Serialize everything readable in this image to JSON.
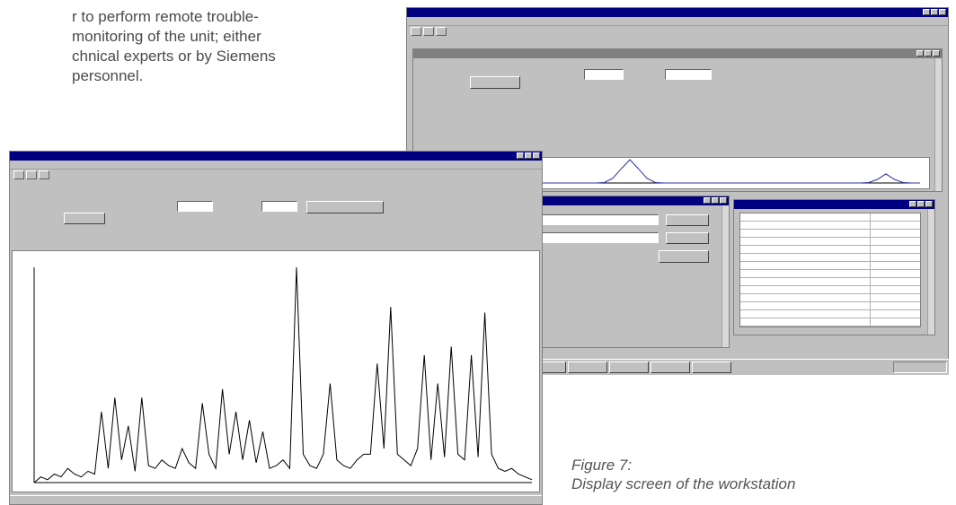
{
  "document": {
    "lines": [
      "r to perform remote trouble-",
      "monitoring of the unit; either",
      "chnical experts or by Siemens",
      "personnel."
    ],
    "caption_line1": "Figure 7:",
    "caption_line2": "Display screen of the workstation"
  },
  "left_window": {
    "title": "",
    "menu": "",
    "status": "",
    "chart_title": ""
  },
  "right_window": {
    "title": "",
    "inner_title": "",
    "button_label": ""
  },
  "method_window": {
    "title": "",
    "rows": [
      "",
      "",
      "",
      "",
      "",
      ""
    ]
  },
  "param_window": {
    "title": "",
    "rows": [
      "",
      "",
      "",
      "",
      "",
      "",
      "",
      "",
      "",
      "",
      "",
      "",
      "",
      ""
    ]
  },
  "chart_data": [
    {
      "type": "line",
      "title": "",
      "xlabel": "",
      "ylabel": "",
      "series": [
        {
          "values": [
            0,
            0.02,
            0.01,
            0.03,
            0.02,
            0.05,
            0.03,
            0.02,
            0.04,
            0.03,
            0.25,
            0.05,
            0.3,
            0.08,
            0.2,
            0.04,
            0.3,
            0.06,
            0.05,
            0.08,
            0.06,
            0.05,
            0.12,
            0.07,
            0.05,
            0.28,
            0.1,
            0.05,
            0.33,
            0.1,
            0.25,
            0.08,
            0.22,
            0.07,
            0.18,
            0.05,
            0.06,
            0.08,
            0.05,
            0.76,
            0.1,
            0.06,
            0.05,
            0.1,
            0.35,
            0.08,
            0.06,
            0.05,
            0.08,
            0.1,
            0.1,
            0.42,
            0.12,
            0.62,
            0.1,
            0.08,
            0.06,
            0.12,
            0.45,
            0.08,
            0.35,
            0.09,
            0.48,
            0.1,
            0.08,
            0.45,
            0.09,
            0.6,
            0.1,
            0.05,
            0.04,
            0.05,
            0.03,
            0.02,
            0.01
          ]
        }
      ]
    },
    {
      "type": "line",
      "title": "",
      "xlabel": "",
      "ylabel": "",
      "series": [
        {
          "values": [
            0,
            0,
            0,
            0,
            0,
            0,
            0,
            0,
            0,
            0,
            0,
            0,
            0,
            0,
            0,
            0,
            0,
            0.02,
            0.2,
            0.6,
            0.98,
            0.6,
            0.2,
            0.02,
            0,
            0,
            0,
            0,
            0,
            0,
            0,
            0,
            0,
            0,
            0,
            0,
            0,
            0,
            0,
            0,
            0,
            0,
            0,
            0,
            0,
            0,
            0,
            0,
            0.02,
            0.15,
            0.38,
            0.15,
            0.02,
            0,
            0
          ]
        }
      ]
    }
  ]
}
